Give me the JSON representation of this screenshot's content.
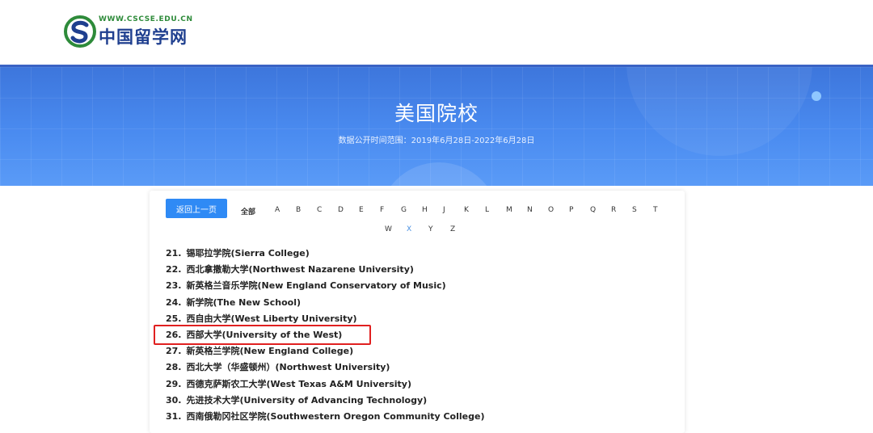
{
  "header": {
    "logo_url": "WWW.CSCSE.EDU.CN",
    "logo_name": "中国留学网"
  },
  "banner": {
    "title": "美国院校",
    "subtitle": "数据公开时间范围：2019年6月28日-2022年6月28日"
  },
  "nav": {
    "back_label": "返回上一页",
    "all_label": "全部",
    "letters": [
      "A",
      "B",
      "C",
      "D",
      "E",
      "F",
      "G",
      "H",
      "J",
      "K",
      "L",
      "M",
      "N",
      "O",
      "P",
      "Q",
      "R",
      "S",
      "T",
      "W",
      "X",
      "Y",
      "Z"
    ],
    "active_letter": "X"
  },
  "schools": [
    {
      "num": "21.",
      "name": "锡耶拉学院(Sierra College)"
    },
    {
      "num": "22.",
      "name": "西北拿撒勒大学(Northwest Nazarene University)"
    },
    {
      "num": "23.",
      "name": "新英格兰音乐学院(New England Conservatory of Music)"
    },
    {
      "num": "24.",
      "name": "新学院(The New School)"
    },
    {
      "num": "25.",
      "name": "西自由大学(West Liberty University)"
    },
    {
      "num": "26.",
      "name": "西部大学(University of the West)"
    },
    {
      "num": "27.",
      "name": "新英格兰学院(New England College)"
    },
    {
      "num": "28.",
      "name": "西北大学（华盛顿州）(Northwest University)"
    },
    {
      "num": "29.",
      "name": "西德克萨斯农工大学(West Texas A&M University)"
    },
    {
      "num": "30.",
      "name": "先进技术大学(University of Advancing Technology)"
    },
    {
      "num": "31.",
      "name": "西南俄勒冈社区学院(Southwestern Oregon Community College)"
    }
  ],
  "colors": {
    "accent": "#2f8af5",
    "highlight_border": "#e02020"
  }
}
